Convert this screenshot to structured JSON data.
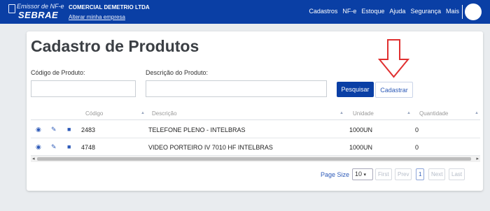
{
  "header": {
    "logo_line1": "Emissor de NF-e",
    "logo_line2": "SEBRAE",
    "company": "COMERCIAL DEMETRIO LTDA",
    "change_company": "Alterar minha empresa",
    "nav": [
      "Cadastros",
      "NF-e",
      "Estoque",
      "Ajuda",
      "Segurança",
      "Mais"
    ]
  },
  "page": {
    "title": "Cadastro de Produtos"
  },
  "filters": {
    "codigo_label": "Código de Produto:",
    "codigo_value": "",
    "descricao_label": "Descrição do Produto:",
    "descricao_value": "",
    "search_button": "Pesquisar",
    "create_button": "Cadastrar"
  },
  "table": {
    "columns": [
      "Código",
      "Descrição",
      "Unidade",
      "Quantidade"
    ],
    "rows": [
      {
        "codigo": "2483",
        "descricao": "TELEFONE PLENO - INTELBRAS",
        "unidade": "1000UN",
        "quantidade": "0"
      },
      {
        "codigo": "4748",
        "descricao": "VIDEO PORTEIRO IV 7010 HF INTELBRAS",
        "unidade": "1000UN",
        "quantidade": "0"
      }
    ]
  },
  "pagination": {
    "page_size_label": "Page Size",
    "page_size": "10",
    "first": "First",
    "prev": "Prev",
    "current": "1",
    "next": "Next",
    "last": "Last"
  },
  "colors": {
    "brand": "#0a3fa5",
    "arrow": "#e03030"
  },
  "icons": [
    "document-icon",
    "eye-icon",
    "pencil-icon",
    "trash-icon",
    "sort-asc-icon",
    "down-arrow-annotation-icon"
  ]
}
